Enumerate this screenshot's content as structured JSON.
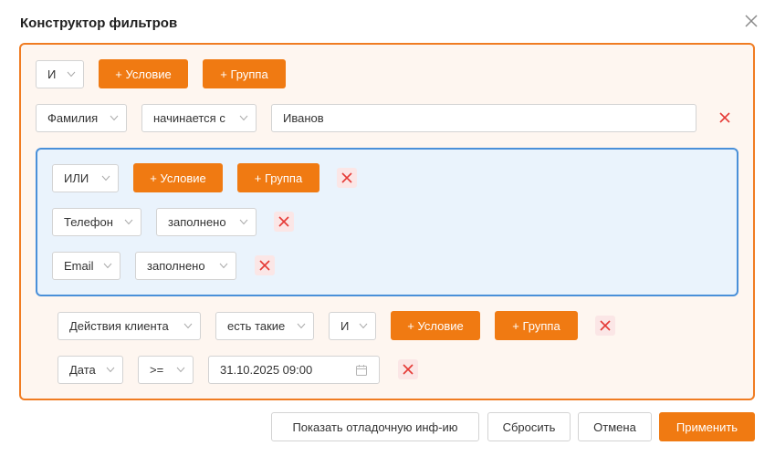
{
  "dialog": {
    "title": "Конструктор фильтров",
    "close_icon": "close-icon"
  },
  "colors": {
    "accent": "#f07a12",
    "root_border": "#f07c22",
    "root_bg": "#fef6f0",
    "or_border": "#4a90d9",
    "or_bg": "#eaf3fc",
    "remove": "#e53935"
  },
  "root_group": {
    "operator": "И",
    "add_condition_label": "+ Условие",
    "add_group_label": "+ Группа",
    "condition_1": {
      "field": "Фамилия",
      "operator": "начинается с",
      "value": "Иванов"
    },
    "or_group": {
      "operator": "ИЛИ",
      "add_condition_label": "+ Условие",
      "add_group_label": "+ Группа",
      "condition_1": {
        "field": "Телефон",
        "operator": "заполнено"
      },
      "condition_2": {
        "field": "Email",
        "operator": "заполнено"
      }
    },
    "actions_condition": {
      "field": "Действия клиента",
      "quantifier": "есть такие",
      "operator": "И",
      "add_condition_label": "+ Условие",
      "add_group_label": "+ Группа",
      "sub_condition": {
        "field": "Дата",
        "operator": ">=",
        "value": "31.10.2025 09:00",
        "icon": "calendar-icon"
      }
    }
  },
  "footer": {
    "debug_label": "Показать отладочную инф-ию",
    "reset_label": "Сбросить",
    "cancel_label": "Отмена",
    "apply_label": "Применить"
  }
}
